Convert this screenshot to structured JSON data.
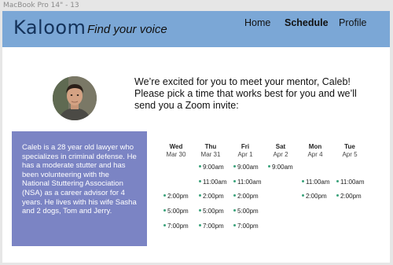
{
  "frame": {
    "label": "MacBook Pro 14\" - 13"
  },
  "header": {
    "logo": "Kaloom",
    "tagline": "Find your voice",
    "nav": [
      {
        "label": "Home",
        "active": false
      },
      {
        "label": "Schedule",
        "active": true
      },
      {
        "label": "Profile",
        "active": false
      }
    ]
  },
  "mentor": {
    "intro": "We’re excited for you to meet your mentor, Caleb! Please pick a time that works best for you and we’ll send you a Zoom invite:",
    "bio": "Caleb is a 28 year old lawyer who specializes in criminal defense. He has a moderate stutter and has been volunteering with the National Stuttering Association (NSA) as a career advisor for 4 years. He lives with his wife Sasha and 2 dogs, Tom and Jerry."
  },
  "schedule": {
    "days": [
      {
        "name": "Wed",
        "date": "Mar 30"
      },
      {
        "name": "Thu",
        "date": "Mar 31"
      },
      {
        "name": "Fri",
        "date": "Apr 1"
      },
      {
        "name": "Sat",
        "date": "Apr 2"
      },
      {
        "name": "Mon",
        "date": "Apr 4"
      },
      {
        "name": "Tue",
        "date": "Apr 5"
      }
    ],
    "slots": {
      "wed": [
        "2:00pm",
        "5:00pm",
        "7:00pm"
      ],
      "thu": [
        "9:00am",
        "11:00am",
        "2:00pm",
        "5:00pm",
        "7:00pm"
      ],
      "fri": [
        "9:00am",
        "11:00am",
        "2:00pm",
        "5:00pm",
        "7:00pm"
      ],
      "sat": [
        "9:00am"
      ],
      "mon": [
        "11:00am",
        "2:00pm"
      ],
      "tue": [
        "11:00am",
        "2:00pm"
      ]
    },
    "available_dot_color": "#3aa27a"
  },
  "colors": {
    "header_bg": "#7ba7d6",
    "bio_bg": "#7b84c4",
    "logo": "#14325a"
  }
}
